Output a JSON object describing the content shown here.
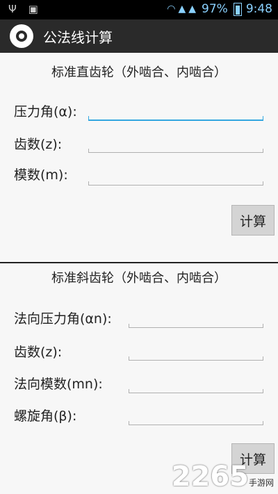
{
  "status_bar": {
    "left_icons": [
      "usb-icon",
      "android-icon"
    ],
    "battery_percent": "97%",
    "time": "9:48"
  },
  "action_bar": {
    "title": "公法线计算",
    "icon": "gear-icon"
  },
  "spur_gear": {
    "title": "标准直齿轮（外啮合、内啮合）",
    "pressure_angle_label": "压力角(α):",
    "teeth_label": "齿数(z):",
    "module_label": "模数(m):",
    "calc_button": "计算"
  },
  "helical_gear": {
    "title": "标准斜齿轮（外啮合、内啮合）",
    "normal_pressure_angle_label": "法向压力角(αn):",
    "teeth_label": "齿数(z):",
    "normal_module_label": "法向模数(mn):",
    "helix_angle_label": "螺旋角(β):",
    "calc_button": "计算"
  },
  "watermark": {
    "number": "2265",
    "text": "手游网"
  }
}
